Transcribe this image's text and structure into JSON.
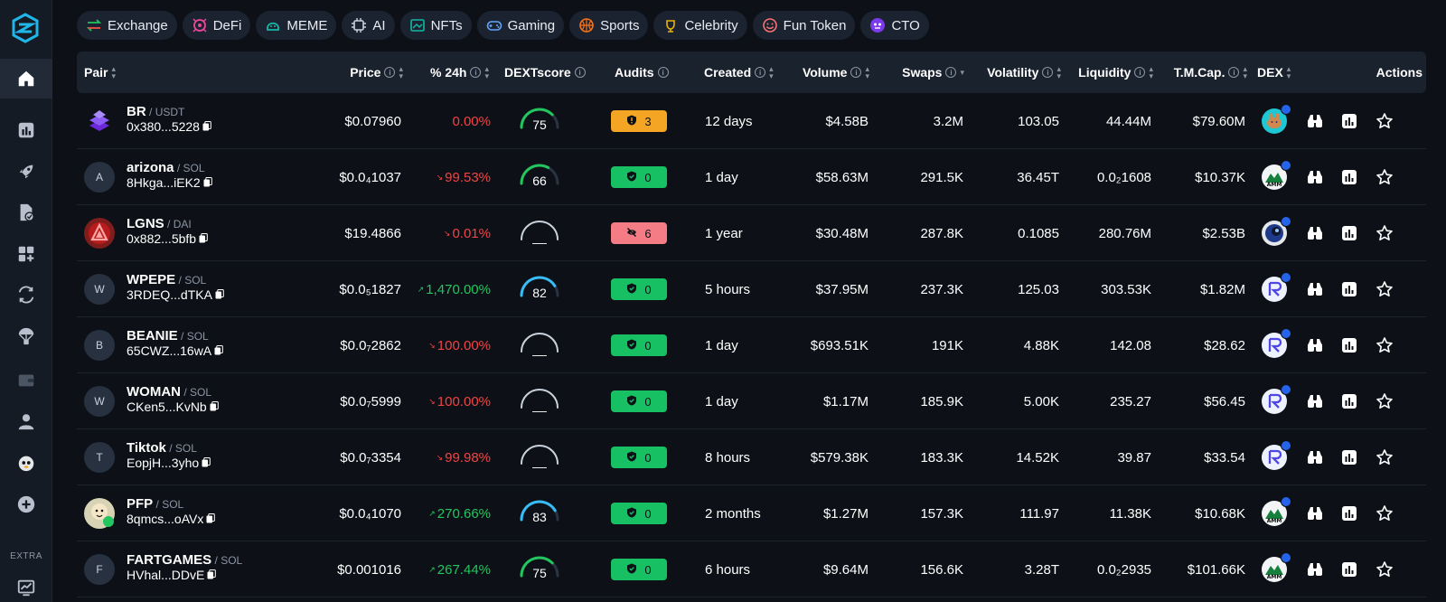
{
  "sidebar": {
    "items": [
      {
        "name": "home-icon",
        "active": true
      },
      {
        "name": "stats-icon",
        "active": false
      },
      {
        "name": "rocket-icon",
        "active": false
      },
      {
        "name": "audit-file-icon",
        "active": false
      },
      {
        "name": "add-widget-icon",
        "active": false
      },
      {
        "name": "swap-icon",
        "active": false
      },
      {
        "name": "airdrop-icon",
        "active": false
      },
      {
        "name": "wallet-icon",
        "active": false
      },
      {
        "name": "user-icon",
        "active": false
      },
      {
        "name": "mascot-icon",
        "active": false
      },
      {
        "name": "plus-circle-icon",
        "active": false
      }
    ],
    "extra_label": "EXTRA"
  },
  "chips": [
    {
      "label": "Exchange",
      "icon": "exchange-icon"
    },
    {
      "label": "DeFi",
      "icon": "defi-icon"
    },
    {
      "label": "MEME",
      "icon": "meme-icon"
    },
    {
      "label": "AI",
      "icon": "chip-icon"
    },
    {
      "label": "NFTs",
      "icon": "nft-icon"
    },
    {
      "label": "Gaming",
      "icon": "gamepad-icon"
    },
    {
      "label": "Sports",
      "icon": "basketball-icon"
    },
    {
      "label": "Celebrity",
      "icon": "celebrity-icon"
    },
    {
      "label": "Fun Token",
      "icon": "smile-icon"
    },
    {
      "label": "CTO",
      "icon": "cto-icon"
    }
  ],
  "headers": {
    "pair": "Pair",
    "price": "Price",
    "change": "% 24h",
    "dextscore": "DEXTscore",
    "audits": "Audits",
    "created": "Created",
    "volume": "Volume",
    "swaps": "Swaps",
    "volatility": "Volatility",
    "liquidity": "Liquidity",
    "tmcap": "T.M.Cap.",
    "dex": "DEX",
    "actions": "Actions"
  },
  "rows": [
    {
      "symbol": "BR",
      "quote": "USDT",
      "address": "0x380...5228",
      "icon_letter": "",
      "price": "$0.07960",
      "change": "0.00%",
      "change_dir": "flat",
      "score": "75",
      "score_fill": 0.75,
      "audit_type": "warn",
      "audit_count": "3",
      "created": "12 days",
      "volume": "$4.58B",
      "swaps": "3.2M",
      "volatility": "103.05",
      "liquidity": "44.44M",
      "tmcap": "$79.60M"
    },
    {
      "symbol": "arizona",
      "quote": "SOL",
      "address": "8Hkga...iEK2",
      "icon_letter": "A",
      "price": "$0.0₄1037",
      "change": "99.53%",
      "change_dir": "down",
      "score": "66",
      "score_fill": 0.66,
      "audit_type": "ok",
      "audit_count": "0",
      "created": "1 day",
      "volume": "$58.63M",
      "swaps": "291.5K",
      "volatility": "36.45T",
      "liquidity": "0.0₂1608",
      "tmcap": "$10.37K"
    },
    {
      "symbol": "LGNS",
      "quote": "DAI",
      "address": "0x882...5bfb",
      "icon_letter": "",
      "price": "$19.4866",
      "change": "0.01%",
      "change_dir": "down",
      "score": "__",
      "score_fill": 0,
      "audit_type": "bad",
      "audit_count": "6",
      "created": "1 year",
      "volume": "$30.48M",
      "swaps": "287.8K",
      "volatility": "0.1085",
      "liquidity": "280.76M",
      "tmcap": "$2.53B"
    },
    {
      "symbol": "WPEPE",
      "quote": "SOL",
      "address": "3RDEQ...dTKA",
      "icon_letter": "W",
      "price": "$0.0₅1827",
      "change": "1,470.00%",
      "change_dir": "up",
      "score": "82",
      "score_fill": 0.82,
      "audit_type": "ok",
      "audit_count": "0",
      "created": "5 hours",
      "volume": "$37.95M",
      "swaps": "237.3K",
      "volatility": "125.03",
      "liquidity": "303.53K",
      "tmcap": "$1.82M"
    },
    {
      "symbol": "BEANIE",
      "quote": "SOL",
      "address": "65CWZ...16wA",
      "icon_letter": "B",
      "price": "$0.0₇2862",
      "change": "100.00%",
      "change_dir": "down",
      "score": "__",
      "score_fill": 0,
      "audit_type": "ok",
      "audit_count": "0",
      "created": "1 day",
      "volume": "$693.51K",
      "swaps": "191K",
      "volatility": "4.88K",
      "liquidity": "142.08",
      "tmcap": "$28.62"
    },
    {
      "symbol": "WOMAN",
      "quote": "SOL",
      "address": "CKen5...KvNb",
      "icon_letter": "W",
      "price": "$0.0₇5999",
      "change": "100.00%",
      "change_dir": "down",
      "score": "__",
      "score_fill": 0,
      "audit_type": "ok",
      "audit_count": "0",
      "created": "1 day",
      "volume": "$1.17M",
      "swaps": "185.9K",
      "volatility": "5.00K",
      "liquidity": "235.27",
      "tmcap": "$56.45"
    },
    {
      "symbol": "Tiktok",
      "quote": "SOL",
      "address": "EopjH...3yho",
      "icon_letter": "T",
      "price": "$0.0₇3354",
      "change": "99.98%",
      "change_dir": "down",
      "score": "__",
      "score_fill": 0,
      "audit_type": "ok",
      "audit_count": "0",
      "created": "8 hours",
      "volume": "$579.38K",
      "swaps": "183.3K",
      "volatility": "14.52K",
      "liquidity": "39.87",
      "tmcap": "$33.54"
    },
    {
      "symbol": "PFP",
      "quote": "SOL",
      "address": "8qmcs...oAVx",
      "icon_letter": "",
      "price": "$0.0₄1070",
      "change": "270.66%",
      "change_dir": "up",
      "score": "83",
      "score_fill": 0.83,
      "audit_type": "ok",
      "audit_count": "0",
      "created": "2 months",
      "volume": "$1.27M",
      "swaps": "157.3K",
      "volatility": "111.97",
      "liquidity": "11.38K",
      "tmcap": "$10.68K"
    },
    {
      "symbol": "FARTGAMES",
      "quote": "SOL",
      "address": "HVhal...DDvE",
      "icon_letter": "F",
      "price": "$0.001016",
      "change": "267.44%",
      "change_dir": "up",
      "score": "75",
      "score_fill": 0.75,
      "audit_type": "ok",
      "audit_count": "0",
      "created": "6 hours",
      "volume": "$9.64M",
      "swaps": "156.6K",
      "volatility": "3.28T",
      "liquidity": "0.0₂2935",
      "tmcap": "$101.66K"
    }
  ],
  "colors": {
    "green": "#22c55e",
    "red": "#ef4444",
    "gauge_green": "#22c55e",
    "gauge_blue": "#38bdf8",
    "gauge_empty": "#c9d1dc"
  }
}
